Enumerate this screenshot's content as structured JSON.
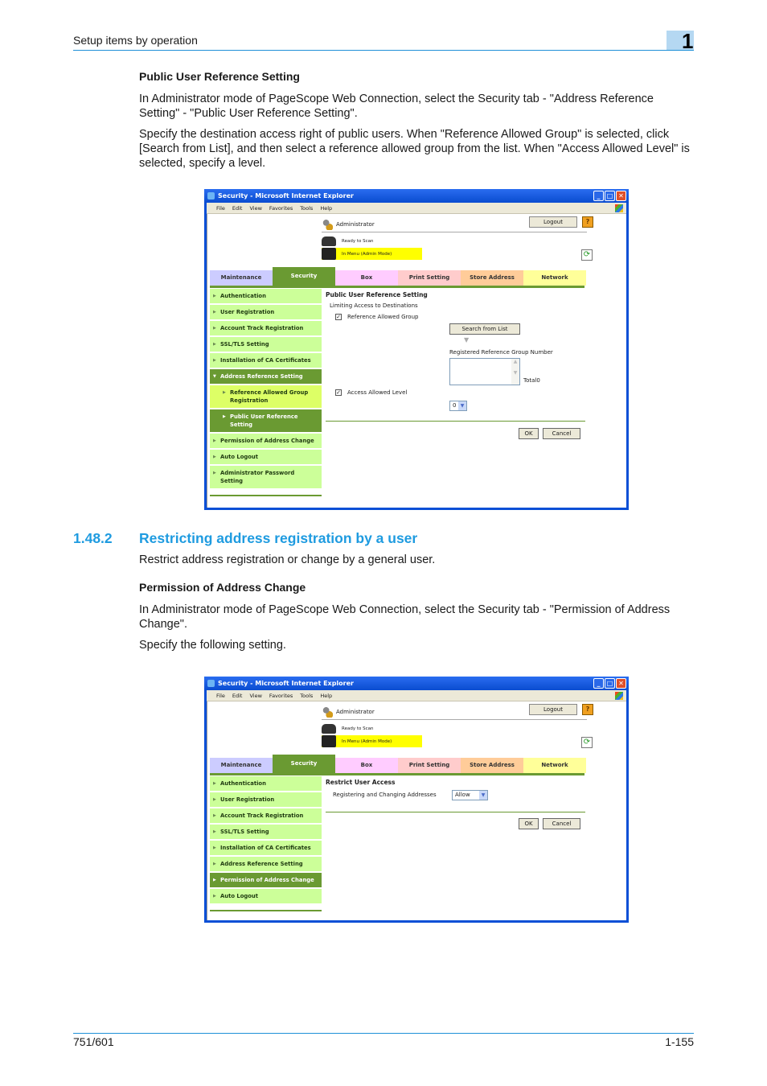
{
  "page": {
    "running_head": "Setup items by operation",
    "chapter_number": "1",
    "footer_left": "751/601",
    "footer_right": "1-155"
  },
  "section1": {
    "heading": "Public User Reference Setting",
    "para1": "In Administrator mode of PageScope Web Connection, select the Security tab - \"Address Reference Setting\" - \"Public User Reference Setting\".",
    "para2": "Specify the destination access right of public users. When \"Reference Allowed Group\" is selected, click [Search from List], and then select a reference allowed group from the list. When \"Access Allowed Level\" is selected, specify a level."
  },
  "section2": {
    "number": "1.48.2",
    "title": "Restricting address registration by a user",
    "intro": "Restrict address registration or change by a general user.",
    "heading": "Permission of Address Change",
    "para1": "In Administrator mode of PageScope Web Connection, select the Security tab - \"Permission of Address Change\".",
    "para2": "Specify the following setting."
  },
  "browser": {
    "title": "Security - Microsoft Internet Explorer",
    "menu": [
      "File",
      "Edit",
      "View",
      "Favorites",
      "Tools",
      "Help"
    ],
    "user": "Administrator",
    "logout": "Logout",
    "help": "?",
    "status_scan": "Ready to Scan",
    "status_mode": "In Menu (Admin Mode)",
    "tabs": [
      {
        "label": "Maintenance",
        "color": "#ccccff"
      },
      {
        "label": "Security",
        "color": "#6a9a32"
      },
      {
        "label": "Box",
        "color": "#ffccff"
      },
      {
        "label": "Print Setting",
        "color": "#ffcccc"
      },
      {
        "label": "Store Address",
        "color": "#ffcc99"
      },
      {
        "label": "Network",
        "color": "#ffff99"
      }
    ]
  },
  "screen1": {
    "sidebar": [
      "Authentication",
      "User Registration",
      "Account Track Registration",
      "SSL/TLS Setting",
      "Installation of CA Certificates",
      "Address Reference Setting",
      "Reference Allowed Group Registration",
      "Public User Reference Setting",
      "Permission of Address Change",
      "Auto Logout",
      "Administrator Password Setting"
    ],
    "content_title": "Public User Reference Setting",
    "limiting_label": "Limiting Access to Destinations",
    "ref_group_label": "Reference Allowed Group",
    "ref_group_checked": true,
    "search_button": "Search from List",
    "registered_label": "Registered Reference Group Number",
    "total_label": "Total0",
    "access_level_label": "Access Allowed Level",
    "access_level_checked": true,
    "access_level_value": "0",
    "ok": "OK",
    "cancel": "Cancel"
  },
  "screen2": {
    "sidebar": [
      "Authentication",
      "User Registration",
      "Account Track Registration",
      "SSL/TLS Setting",
      "Installation of CA Certificates",
      "Address Reference Setting",
      "Permission of Address Change",
      "Auto Logout"
    ],
    "content_title": "Restrict User Access",
    "field_label": "Registering and Changing Addresses",
    "field_value": "Allow",
    "ok": "OK",
    "cancel": "Cancel"
  }
}
